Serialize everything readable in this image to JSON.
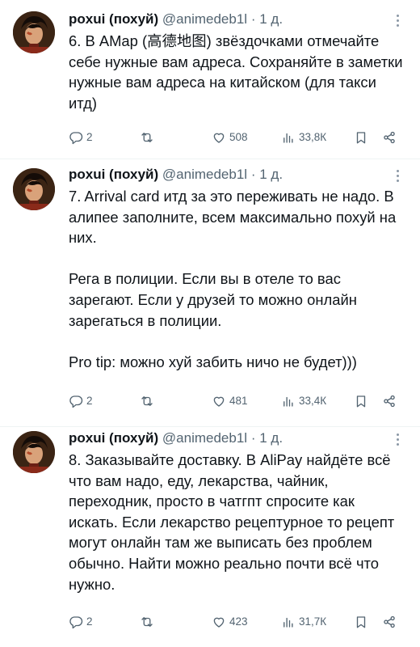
{
  "tweets": [
    {
      "author_name": "poxui (похуй)",
      "handle": "@animedeb1l",
      "separator": "·",
      "time": "1 д.",
      "text": "6. В AMap (高德地图) звёздочками отмечайте себе нужные вам адреса. Сохраняйте в заметки нужные вам адреса на китайском (для такси итд)",
      "replies": "2",
      "reposts": "",
      "likes": "508",
      "views": "33,8К"
    },
    {
      "author_name": "poxui (похуй)",
      "handle": "@animedeb1l",
      "separator": "·",
      "time": "1 д.",
      "text": "7. Arrival card итд за это переживать не надо. В алипее заполните, всем максимально похуй на них.\n\nРега в полиции. Если вы в отеле то вас зарегают. Если у друзей то можно онлайн зарегаться в полиции.\n\nPro tip: можно хуй забить ничо не будет)))",
      "replies": "2",
      "reposts": "",
      "likes": "481",
      "views": "33,4К"
    },
    {
      "author_name": "poxui (похуй)",
      "handle": "@animedeb1l",
      "separator": "·",
      "time": "1 д.",
      "text": "8. Заказывайте доставку. В AliPay найдёте всё что вам надо, еду, лекарства, чайник, переходник, просто в чатгпт спросите как искать. Если лекарство рецептурное то рецепт могут онлайн там же выписать без проблем обычно. Найти можно реально почти всё что нужно.",
      "replies": "2",
      "reposts": "",
      "likes": "423",
      "views": "31,7К"
    }
  ],
  "icons": {
    "reply": "reply-icon",
    "repost": "repost-icon",
    "like": "heart-icon",
    "views": "views-icon",
    "bookmark": "bookmark-icon",
    "share": "share-icon",
    "more": "more-dots-icon"
  },
  "colors": {
    "text": "#0f1419",
    "secondary": "#536471",
    "divider": "#eff3f4",
    "background": "#ffffff"
  }
}
